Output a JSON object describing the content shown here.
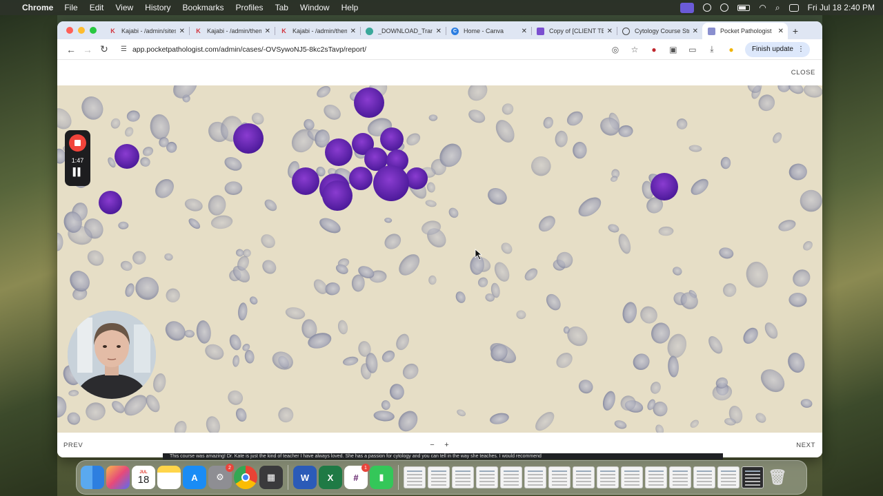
{
  "menubar": {
    "app_name": "Chrome",
    "menus": [
      "File",
      "Edit",
      "View",
      "History",
      "Bookmarks",
      "Profiles",
      "Tab",
      "Window",
      "Help"
    ],
    "datetime": "Fri Jul 18  2:40 PM"
  },
  "browser": {
    "tabs": [
      {
        "title": "Kajabi - /admin/sites/",
        "favicon": "kajabi-icon",
        "color": "#d2323c"
      },
      {
        "title": "Kajabi - /admin/theme",
        "favicon": "kajabi-icon",
        "color": "#d2323c"
      },
      {
        "title": "Kajabi - /admin/theme",
        "favicon": "kajabi-icon",
        "color": "#d2323c"
      },
      {
        "title": "_DOWNLOAD_Transf",
        "favicon": "download-icon",
        "color": "#3aa89a"
      },
      {
        "title": "Home - Canva",
        "favicon": "canva-icon",
        "color": "#2a7de1"
      },
      {
        "title": "Copy of [CLIENT TEM",
        "favicon": "form-icon",
        "color": "#7b4fd0"
      },
      {
        "title": "Cytology Course Stra",
        "favicon": "chatgpt-icon",
        "color": "#444444"
      },
      {
        "title": "Pocket Pathologist",
        "favicon": "page-icon",
        "color": "#8a8fcf",
        "active": true
      }
    ],
    "url": "app.pocketpathologist.com/admin/cases/-OVSywoNJ5-8kc2sTavp/report/",
    "finish_update_label": "Finish update"
  },
  "viewer": {
    "close_label": "CLOSE",
    "prev_label": "PREV",
    "next_label": "NEXT",
    "zoom_out_label": "−",
    "zoom_in_label": "+"
  },
  "recorder": {
    "elapsed": "1:47"
  },
  "caption": {
    "text": "This course was amazing! Dr. Kate is just the kind of teacher I have always loved. She has a passion for cytology and you can tell in the way she teaches. I would recommend"
  },
  "dock": {
    "calendar_month": "JUL",
    "calendar_day": "18",
    "settings_badge": "2",
    "slack_badge": "1"
  }
}
